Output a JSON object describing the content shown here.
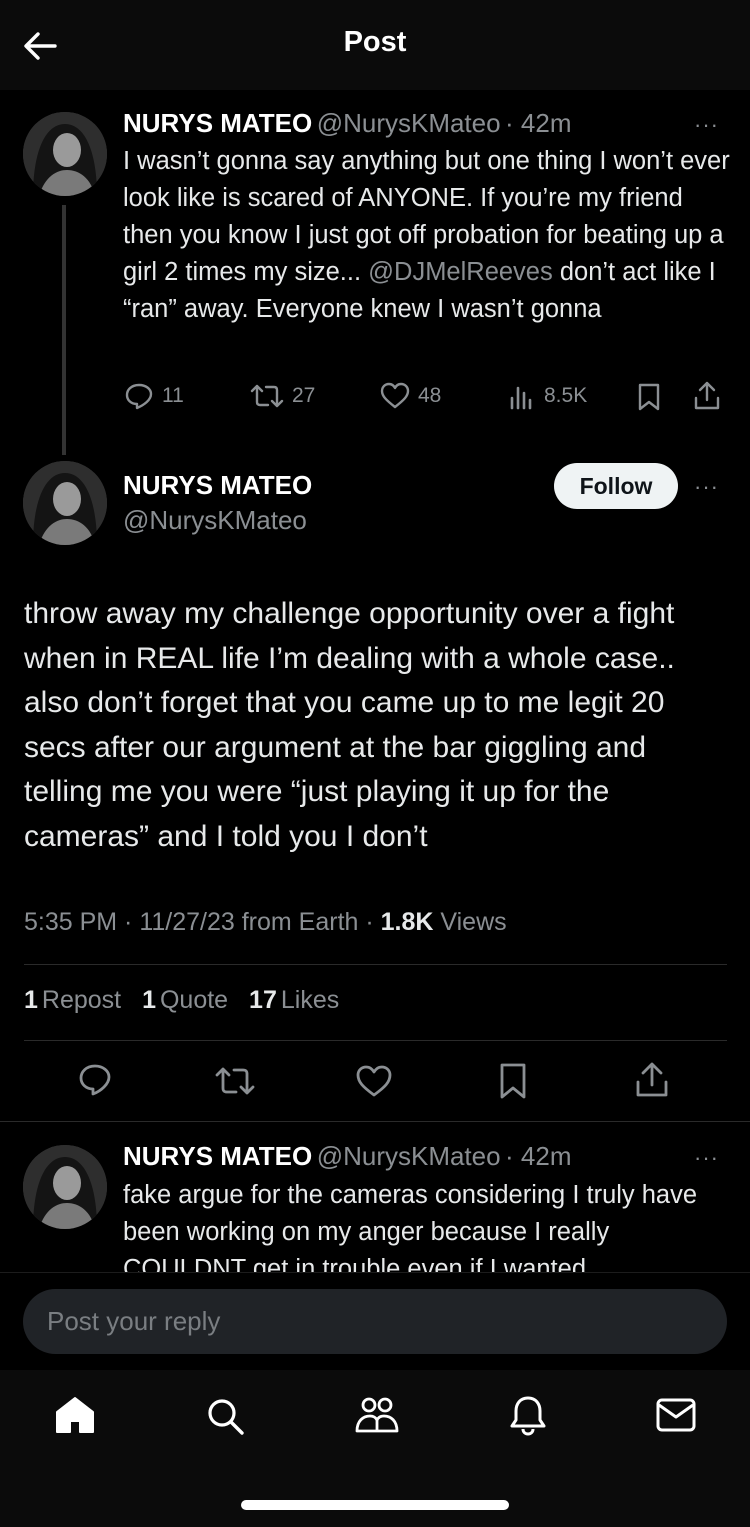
{
  "header": {
    "title": "Post"
  },
  "parent_post": {
    "name": "NURYS MATEO",
    "handle": "@NurysKMateo",
    "time": "· 42m",
    "more": "···",
    "text_part1": "I wasn’t gonna say anything but one thing I won’t ever look like is scared of ANYONE. If you’re my friend then you know I just got off probation for beating up a girl 2 times my size...",
    "mention": "@DJMelReeves",
    "text_part2": " don’t act like I “ran” away. Everyone knew I wasn’t gonna",
    "replies": "11",
    "reposts": "27",
    "likes": "48",
    "views": "8.5K"
  },
  "main_post": {
    "name": "NURYS MATEO",
    "handle": "@NurysKMateo",
    "follow_label": "Follow",
    "more": "···",
    "text": "throw away my challenge opportunity over a fight when in REAL life I’m dealing with a whole case.. also don’t forget that you came up to me legit 20 secs after our argument at the bar giggling and telling me you were “just playing it up for the cameras” and I told you I don’t",
    "timestamp": "5:35 PM · 11/27/23 from Earth · ",
    "views_count": "1.8K",
    "views_label": " Views",
    "repost_count": "1",
    "repost_label": "Repost",
    "quote_count": "1",
    "quote_label": "Quote",
    "likes_count": "17",
    "likes_label": "Likes"
  },
  "reply_post": {
    "name": "NURYS MATEO",
    "handle": "@NurysKMateo",
    "time": "· 42m",
    "more": "···",
    "text": "fake argue for the cameras considering I truly have been working on my anger because I really COULDNT get in trouble even if I wanted"
  },
  "reply_bar": {
    "placeholder": "Post your reply"
  },
  "tabbar": {
    "items": [
      "home-icon",
      "search-icon",
      "communities-icon",
      "notifications-icon",
      "messages-icon"
    ]
  },
  "colors": {
    "background": "#000000",
    "text": "#e7e9ea",
    "muted": "#8b8f93",
    "follow_bg": "#eff3f4"
  }
}
